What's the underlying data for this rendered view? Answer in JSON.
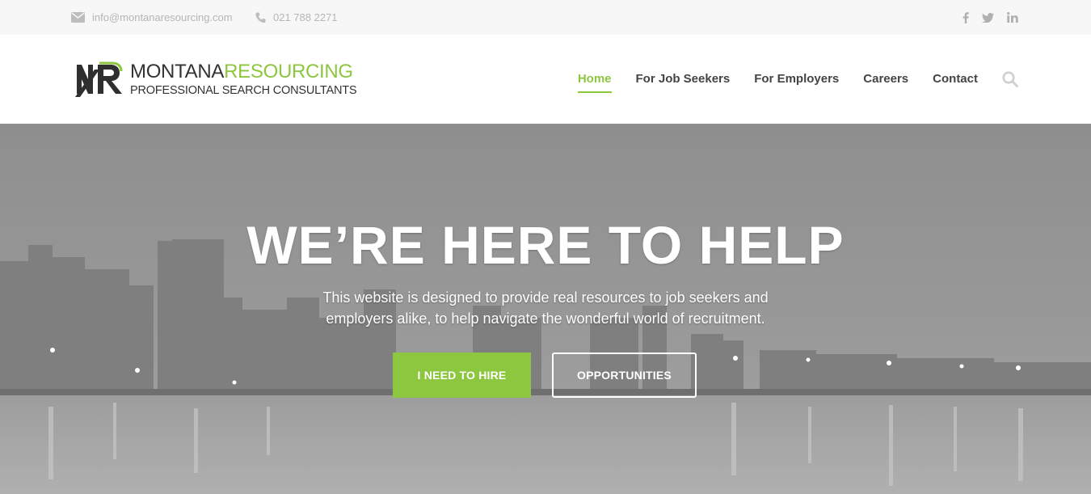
{
  "topbar": {
    "email": "info@montanaresourcing.com",
    "phone": "021 788 2271",
    "social": [
      {
        "icon": "facebook-icon",
        "glyph": "f"
      },
      {
        "icon": "twitter-icon",
        "glyph": "t"
      },
      {
        "icon": "linkedin-icon",
        "glyph": "in"
      }
    ]
  },
  "brand": {
    "name_part1": "MONTANA",
    "name_part2": "RESOURCING",
    "tagline": "PROFESSIONAL SEARCH CONSULTANTS",
    "accent_color": "#8dc63f"
  },
  "nav": {
    "items": [
      {
        "label": "Home",
        "active": true
      },
      {
        "label": "For Job Seekers",
        "active": false
      },
      {
        "label": "For Employers",
        "active": false
      },
      {
        "label": "Careers",
        "active": false
      },
      {
        "label": "Contact",
        "active": false
      }
    ],
    "search_icon": "search-icon"
  },
  "hero": {
    "headline": "WE’RE HERE TO HELP",
    "subtext": "This website is designed to provide real resources to job seekers and employers alike, to help navigate the wonderful world of recruitment.",
    "primary_button": "I NEED TO HIRE",
    "secondary_button": "OPPORTUNITIES"
  }
}
